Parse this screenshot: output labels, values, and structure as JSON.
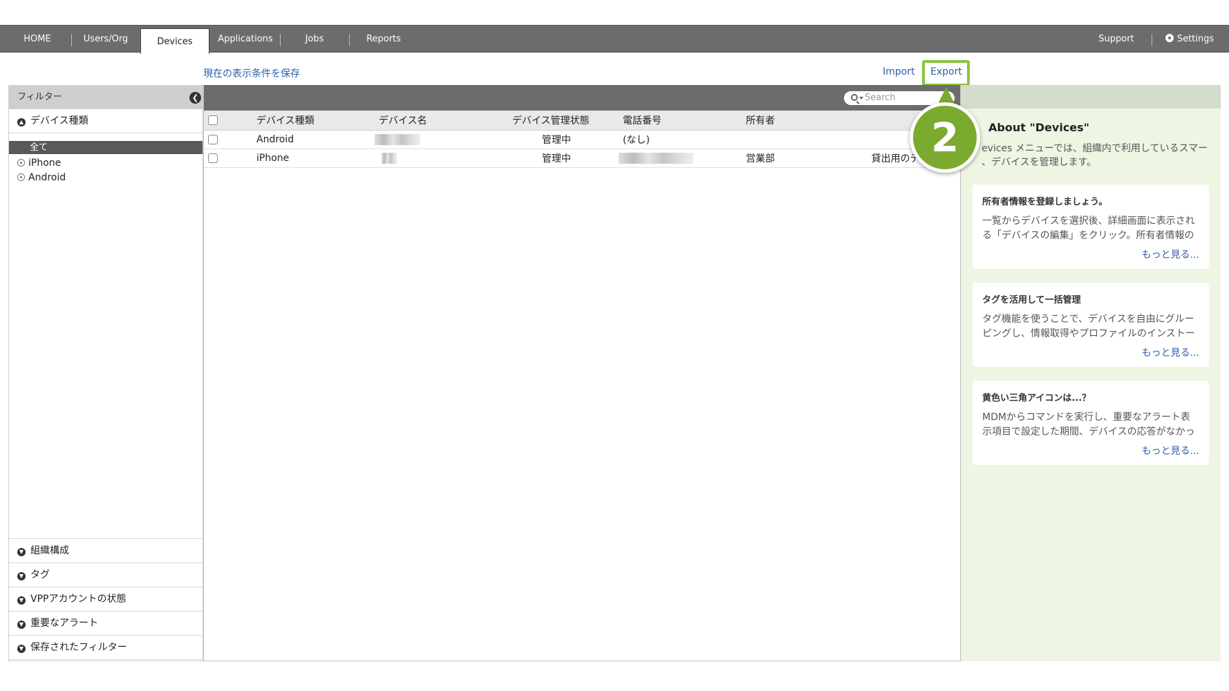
{
  "nav": {
    "items": [
      "HOME",
      "Users/Org",
      "Devices",
      "Applications",
      "Jobs",
      "Reports"
    ],
    "active": "Devices",
    "support": "Support",
    "settings": "Settings"
  },
  "actions": {
    "save_view": "現在の表示条件を保存",
    "import": "Import",
    "export": "Export"
  },
  "sidebar": {
    "header": "フィルター",
    "device_type_section": "デバイス種類",
    "options": [
      "全て",
      "iPhone",
      "Android"
    ],
    "bottom_sections": [
      "組織構成",
      "タグ",
      "VPPアカウントの状態",
      "重要なアラート",
      "保存されたフィルター"
    ]
  },
  "table": {
    "search_placeholder": "Search",
    "headers": [
      "デバイス種類",
      "デバイス名",
      "デバイス管理状態",
      "電話番号",
      "所有者"
    ],
    "rows": [
      {
        "type": "Android",
        "status": "管理中",
        "phone": "(なし)",
        "owner": "",
        "extra": ""
      },
      {
        "type": "iPhone",
        "status": "管理中",
        "phone": "",
        "owner": "営業部",
        "extra": "貸出用のデ"
      }
    ]
  },
  "help": {
    "title": "About \"Devices\"",
    "intro": "evices メニューでは、組織内で利用しているスマー\n、デバイスを管理します。",
    "cards": [
      {
        "title": "所有者情報を登録しましょう。",
        "body": "一覧からデバイスを選択後、詳細画面に表示される「デバイスの編集」をクリック。所有者情報の",
        "more": "もっと見る..."
      },
      {
        "title": "タグを活用して一括管理",
        "body": "タグ機能を使うことで、デバイスを自由にグルーピングし、情報取得やプロファイルのインストー",
        "more": "もっと見る..."
      },
      {
        "title": "黄色い三角アイコンは...？",
        "body": "MDMからコマンドを実行し、重要なアラート表示項目で設定した期間、デバイスの応答がなかっ",
        "more": "もっと見る..."
      }
    ]
  },
  "callout": {
    "number": "2"
  },
  "colors": {
    "accent": "#7aab2e",
    "highlight": "#8cc43c",
    "link": "#2b5fa8",
    "nav_bg": "#6c6c6c"
  }
}
